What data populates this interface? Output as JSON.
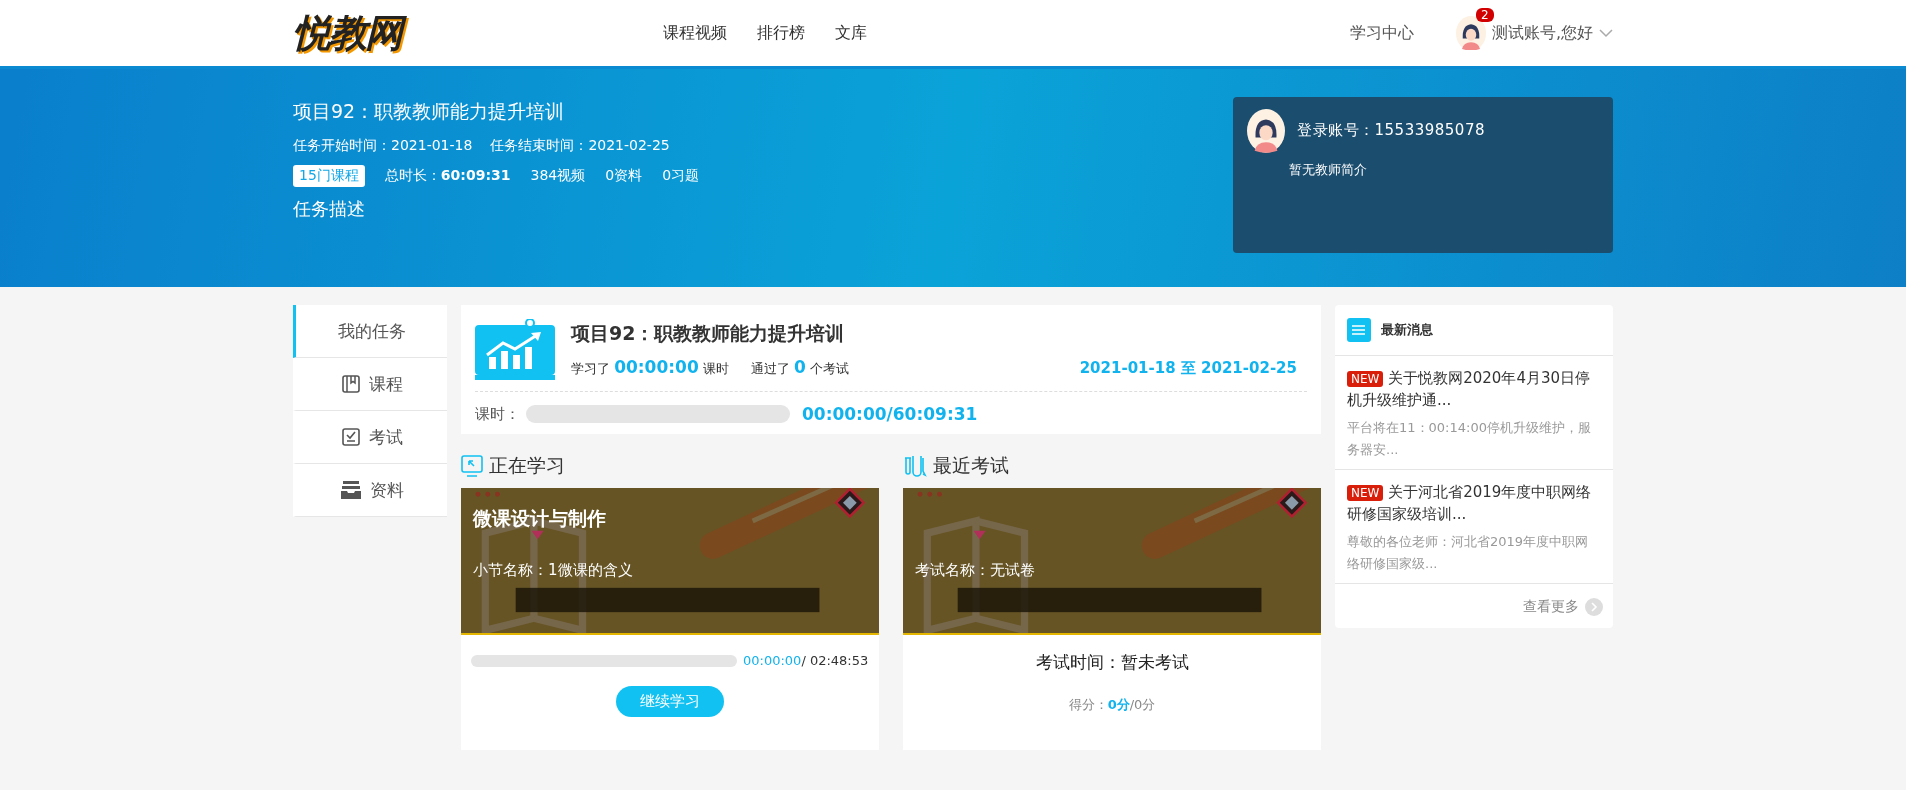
{
  "header": {
    "logo": "悦教网",
    "nav": [
      {
        "label": "课程视频",
        "selected": false
      },
      {
        "label": "排行榜",
        "selected": false
      },
      {
        "label": "文库",
        "selected": false
      }
    ],
    "study_center": "学习中心",
    "notification_count": "2",
    "user_greeting": "测试账号,您好"
  },
  "banner": {
    "title": "项目92：职教教师能力提升培训",
    "start": "任务开始时间：2021-01-18",
    "end": "任务结束时间：2021-02-25",
    "course_count": "15门课程",
    "stats": [
      "总时长：**60:09:31**",
      "384视频",
      "0资料",
      "0习题"
    ],
    "description": "任务描述",
    "teacher": {
      "account": "登录账号：15533985078",
      "intro": "暂无教师简介"
    }
  },
  "sidebar": {
    "items": [
      {
        "label": "我的任务",
        "kind": "plain",
        "selected": true
      },
      {
        "label": "课程",
        "kind": "book",
        "selected": false
      },
      {
        "label": "考试",
        "kind": "check",
        "selected": false
      },
      {
        "label": "资料",
        "kind": "tray",
        "selected": false
      }
    ]
  },
  "task": {
    "title": "项目92：职教教师能力提升培训",
    "studied_prefix": "学习了",
    "studied": "00:00:00",
    "studied_suffix": "课时",
    "passed_prefix": "通过了",
    "passed": "0",
    "passed_suffix": "个考试",
    "dates": "2021-01-18 至 2021-02-25",
    "hours_label": "课时：",
    "level": 0,
    "hours": "00:00:00/60:09:31"
  },
  "studying": {
    "heading": "正在学习",
    "course": "微课设计与制作",
    "section": "小节名称：1微课的含义",
    "level": 0,
    "elapsed": "00:00:00",
    "total": "/ 02:48:53",
    "button": "继续学习"
  },
  "exam": {
    "heading": "最近考试",
    "name": "考试名称：无试卷",
    "time": "考试时间：暂未考试",
    "score_label": "得分：",
    "score": "0分",
    "score_total": "/0分"
  },
  "news": {
    "heading": "最新消息",
    "items": [
      {
        "badge": "NEW",
        "title": "关于悦教网2020年4月30日停机升级维护通...",
        "summary": "平台将在11：00:14:00停机升级维护，服务器安..."
      },
      {
        "badge": "NEW",
        "title": "关于河北省2019年度中职网络研修国家级培训...",
        "summary": "尊敬的各位老师：河北省2019年度中职网络研修国家级..."
      }
    ],
    "more": "查看更多"
  }
}
